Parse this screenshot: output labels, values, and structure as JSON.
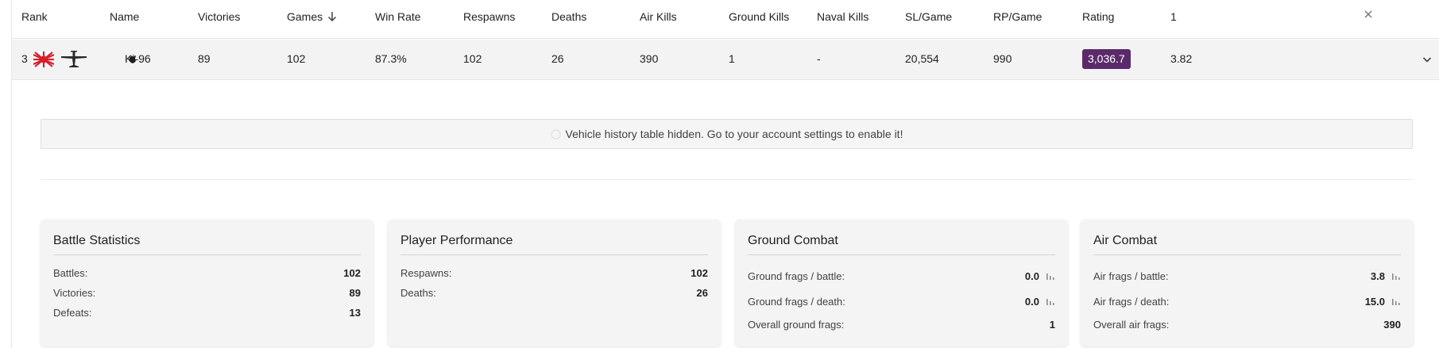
{
  "table": {
    "headers": {
      "rank": "Rank",
      "name": "Name",
      "victories": "Victories",
      "games": "Games",
      "win_rate": "Win Rate",
      "respawns": "Respawns",
      "deaths": "Deaths",
      "air_kills": "Air Kills",
      "ground_kills": "Ground Kills",
      "naval_kills": "Naval Kills",
      "sl_game": "SL/Game",
      "rp_game": "RP/Game",
      "rating": "Rating",
      "extra": "1"
    },
    "row": {
      "rank": "3",
      "name": "Ki-96",
      "victories": "89",
      "games": "102",
      "win_rate": "87.3%",
      "respawns": "102",
      "deaths": "26",
      "air_kills": "390",
      "ground_kills": "1",
      "naval_kills": "-",
      "sl_game": "20,554",
      "rp_game": "990",
      "rating": "3,036.7",
      "extra": "3.82"
    }
  },
  "notice": {
    "text": "Vehicle history table hidden. Go to your account settings to enable it!"
  },
  "cards": {
    "battle": {
      "title": "Battle Statistics",
      "stats": [
        {
          "label": "Battles:",
          "value": "102"
        },
        {
          "label": "Victories:",
          "value": "89"
        },
        {
          "label": "Defeats:",
          "value": "13"
        }
      ]
    },
    "performance": {
      "title": "Player Performance",
      "stats": [
        {
          "label": "Respawns:",
          "value": "102"
        },
        {
          "label": "Deaths:",
          "value": "26"
        }
      ]
    },
    "ground": {
      "title": "Ground Combat",
      "stats": [
        {
          "label": "Ground frags / battle:",
          "value": "0.0"
        },
        {
          "label": "Ground frags / death:",
          "value": "0.0"
        },
        {
          "label": "Overall ground frags:",
          "value": "1"
        }
      ]
    },
    "air": {
      "title": "Air Combat",
      "stats": [
        {
          "label": "Air frags / battle:",
          "value": "3.8"
        },
        {
          "label": "Air frags / death:",
          "value": "15.0"
        },
        {
          "label": "Overall air frags:",
          "value": "390"
        }
      ]
    }
  },
  "colors": {
    "rating_badge": "#5a2a6a",
    "row_background": "#f3f3f3",
    "card_background": "#f4f4f4"
  },
  "icons": {
    "sort": "arrow-down-icon",
    "close": "close-icon",
    "flag": "japan-rising-sun-flag-icon",
    "vehicle_type": "fighter-plane-icon",
    "vehicle_class": "vehicle-class-icon",
    "expand": "chevron-down-icon",
    "notice": "info-icon",
    "chart": "bar-chart-icon"
  }
}
